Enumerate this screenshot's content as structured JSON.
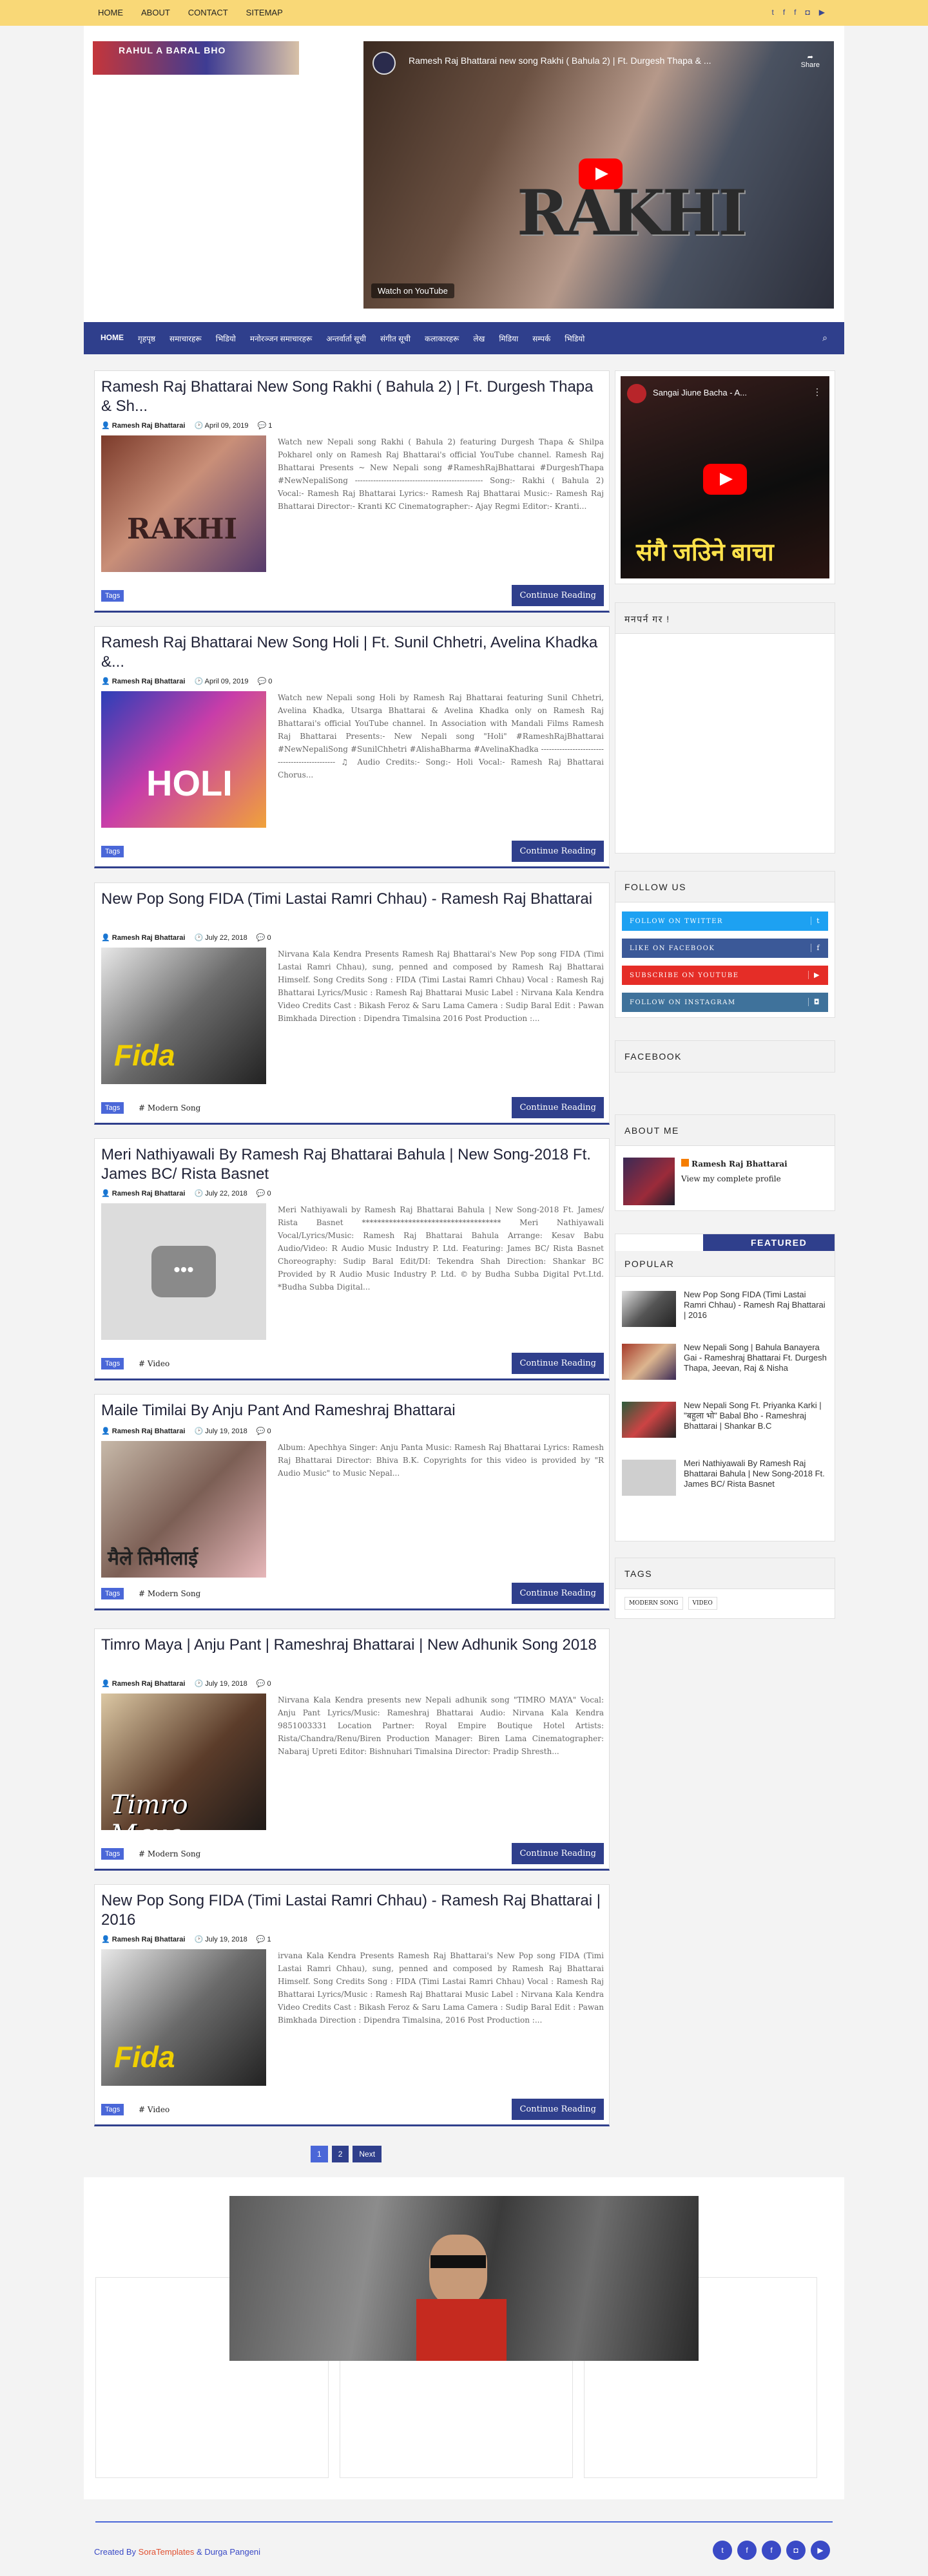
{
  "topnav": {
    "items": [
      "HOME",
      "ABOUT",
      "CONTACT",
      "SITEMAP"
    ],
    "social": [
      "twitter-icon",
      "facebook-icon",
      "facebook-icon",
      "instagram-icon",
      "youtube-icon"
    ]
  },
  "header": {
    "logo_text": "RAHUL A  BARAL BHO",
    "video_title": "Ramesh Raj Bhattarai new song Rakhi ( Bahula 2) | Ft. Durgesh Thapa & ...",
    "video_share": "Share",
    "video_overlay": "RAKHI",
    "video_watch": "Watch on  YouTube"
  },
  "mainnav": {
    "items": [
      "HOME",
      "गृहपृष्ठ",
      "समाचारहरू",
      "भिडियो",
      "मनोरञ्जन समाचारहरू",
      "अन्तर्वार्ता सूची",
      "संगीत सूची",
      "कलाकारहरू",
      "लेख",
      "मिडिया",
      "सम्पर्क",
      "भिडियो"
    ],
    "search": "search"
  },
  "posts": [
    {
      "title": "Ramesh Raj Bhattarai New Song Rakhi ( Bahula 2) | Ft. Durgesh Thapa & Sh...",
      "author": "Ramesh Raj Bhattarai",
      "date": "April 09, 2019",
      "comments": "1",
      "snippet": "Watch new Nepali song Rakhi ( Bahula 2) featuring Durgesh Thapa & Shilpa Pokharel only on Ramesh Raj Bhattarai's official YouTube channel. Ramesh Raj Bhattarai Presents ~ New Nepali song #RameshRajBhattarai #DurgeshThapa #NewNepaliSong ------------------------------------------------- Song:- Rakhi ( Bahula 2) Vocal:- Ramesh Raj Bhattarai Lyrics:- Ramesh Raj Bhattarai Music:- Ramesh Raj Bhattarai Director:- Kranti KC Cinematographer:- Ajay Regmi Editor:- Kranti...",
      "tags": "Tags",
      "label": "",
      "cont": "Continue Reading"
    },
    {
      "title": "Ramesh Raj Bhattarai New Song Holi | Ft. Sunil Chhetri, Avelina Khadka &...",
      "author": "Ramesh Raj Bhattarai",
      "date": "April 09, 2019",
      "comments": "0",
      "snippet": "Watch new Nepali song Holi by Ramesh Raj Bhattarai featuring Sunil Chhetri, Avelina Khadka, Utsarga Bhattarai & Avelina Khadka only on Ramesh Raj Bhattarai's official YouTube channel. In Association with Mandali Films Ramesh Raj Bhattarai Presents:- New Nepali song \"Holi\" #RameshRajBhattarai #NewNepaliSong #SunilChhetri #AlishaBharma #AvelinaKhadka ---------------------------------------------- ♫ Audio Credits:- Song:- Holi Vocal:- Ramesh Raj Bhattarai Chorus...",
      "tags": "Tags",
      "label": "",
      "cont": "Continue Reading"
    },
    {
      "title": "New Pop Song FIDA (Timi Lastai Ramri Chhau) - Ramesh Raj Bhattarai",
      "author": "Ramesh Raj Bhattarai",
      "date": "July 22, 2018",
      "comments": "0",
      "snippet": "Nirvana Kala Kendra Presents Ramesh Raj Bhattarai's New Pop song FIDA (Timi Lastai Ramri Chhau), sung, penned and composed by Ramesh Raj Bhattarai Himself. Song Credits Song : FIDA (Timi Lastai Ramri Chhau) Vocal : Ramesh Raj Bhattarai Lyrics/Music : Ramesh Raj Bhattarai Music Label : Nirvana Kala Kendra Video Credits Cast : Bikash Feroz & Saru Lama Camera : Sudip Baral Edit : Pawan Bimkhada Direction : Dipendra Timalsina 2016 Post Production :...",
      "tags": "Tags",
      "label": "# Modern Song",
      "cont": "Continue Reading"
    },
    {
      "title": "Meri Nathiyawali By Ramesh Raj Bhattarai Bahula | New Song-2018 Ft. James BC/ Rista Basnet",
      "author": "Ramesh Raj Bhattarai",
      "date": "July 22, 2018",
      "comments": "0",
      "snippet": "Meri Nathiyawali by Ramesh Raj Bhattarai Bahula | New Song-2018 Ft. James/ Rista Basnet ************************************ Meri Nathiyawali Vocal/Lyrics/Music: Ramesh Raj Bhattarai Bahula Arrange: Kesav Babu Audio/Video: R Audio Music Industry P. Ltd. Featuring: James BC/ Rista Basnet Choreography: Sudip Baral Edit/DI: Tekendra Shah Direction: Shankar BC Provided by R Audio Music Industry P. Ltd. © by Budha Subba Digital Pvt.Ltd. *Budha Subba Digital...",
      "tags": "Tags",
      "label": "# Video",
      "cont": "Continue Reading"
    },
    {
      "title": "Maile Timilai By Anju Pant And Rameshraj Bhattarai",
      "author": "Ramesh Raj Bhattarai",
      "date": "July 19, 2018",
      "comments": "0",
      "snippet": "Album: Apechhya Singer: Anju Panta Music: Ramesh Raj Bhattarai Lyrics: Ramesh Raj Bhattarai Director: Bhiva B.K. Copyrights for this video is provided by \"R Audio Music\" to Music Nepal...",
      "tags": "Tags",
      "label": "# Modern Song",
      "cont": "Continue Reading"
    },
    {
      "title": "Timro Maya | Anju Pant | Rameshraj Bhattarai | New Adhunik Song 2018",
      "author": "Ramesh Raj Bhattarai",
      "date": "July 19, 2018",
      "comments": "0",
      "snippet": "Nirvana Kala Kendra presents new Nepali adhunik song \"TIMRO MAYA\" Vocal: Anju Pant Lyrics/Music: Rameshraj Bhattarai Audio: Nirvana Kala Kendra 9851003331 Location Partner: Royal Empire Boutique Hotel Artists: Rista/Chandra/Renu/Biren Production Manager: Biren Lama Cinematographer: Nabaraj Upreti Editor: Bishnuhari Timalsina Director: Pradip Shresth...",
      "tags": "Tags",
      "label": "# Modern Song",
      "cont": "Continue Reading"
    },
    {
      "title": "New Pop Song FIDA (Timi Lastai Ramri Chhau) - Ramesh Raj Bhattarai | 2016",
      "author": "Ramesh Raj Bhattarai",
      "date": "July 19, 2018",
      "comments": "1",
      "snippet": "irvana Kala Kendra Presents Ramesh Raj Bhattarai's New Pop song FIDA (Timi Lastai Ramri Chhau), sung, penned and composed by Ramesh Raj Bhattarai Himself. Song Credits Song : FIDA (Timi Lastai Ramri Chhau) Vocal : Ramesh Raj Bhattarai Lyrics/Music : Ramesh Raj Bhattarai Music Label : Nirvana Kala Kendra Video Credits Cast : Bikash Feroz & Saru Lama Camera : Sudip Baral Edit : Pawan Bimkhada Direction : Dipendra Timalsina, 2016 Post Production :...",
      "tags": "Tags",
      "label": "# Video",
      "cont": "Continue Reading"
    }
  ],
  "sidebar": {
    "video_title": "Sangai Jiune Bacha - A...",
    "video_overlay": "संगै जउिने बाचा",
    "box2_title": "मनपर्न गर !",
    "follow_title": "FOLLOW US",
    "follow": [
      {
        "label": "FOLLOW ON TWITTER",
        "icon": "twitter-icon",
        "color": "#1da1f2"
      },
      {
        "label": "LIKE ON FACEBOOK",
        "icon": "facebook-icon",
        "color": "#3b5998"
      },
      {
        "label": "SUBSCRIBE ON YOUTUBE",
        "icon": "youtube-icon",
        "color": "#e52d27"
      },
      {
        "label": "FOLLOW ON INSTAGRAM",
        "icon": "instagram-icon",
        "color": "#3f729b"
      }
    ],
    "facebook_title": "FACEBOOK",
    "about_title": "ABOUT ME",
    "about_name": "Ramesh Raj Bhattarai",
    "about_link": "View my complete profile",
    "featured": "FEATURED",
    "popular_title": "POPULAR",
    "popular": [
      "New Pop Song FIDA (Timi Lastai Ramri Chhau) - Ramesh Raj Bhattarai | 2016",
      "New Nepali Song | Bahula Banayera Gai - Rameshraj Bhattarai Ft. Durgesh Thapa, Jeevan, Raj & Nisha",
      "New Nepali Song Ft. Priyanka Karki | \"बहुला भो\" Babal Bho - Rameshraj Bhattarai | Shankar B.C",
      "Meri Nathiyawali By Ramesh Raj Bhattarai Bahula | New Song-2018 Ft. James BC/ Rista Basnet"
    ],
    "tags_title": "TAGS",
    "tags": [
      "MODERN SONG",
      "VIDEO"
    ]
  },
  "pager": [
    "1",
    "2",
    "Next"
  ],
  "footer": {
    "created": "Created By",
    "sora": "SoraTemplates",
    "and": "&",
    "durga": "Durga Pangeni"
  }
}
